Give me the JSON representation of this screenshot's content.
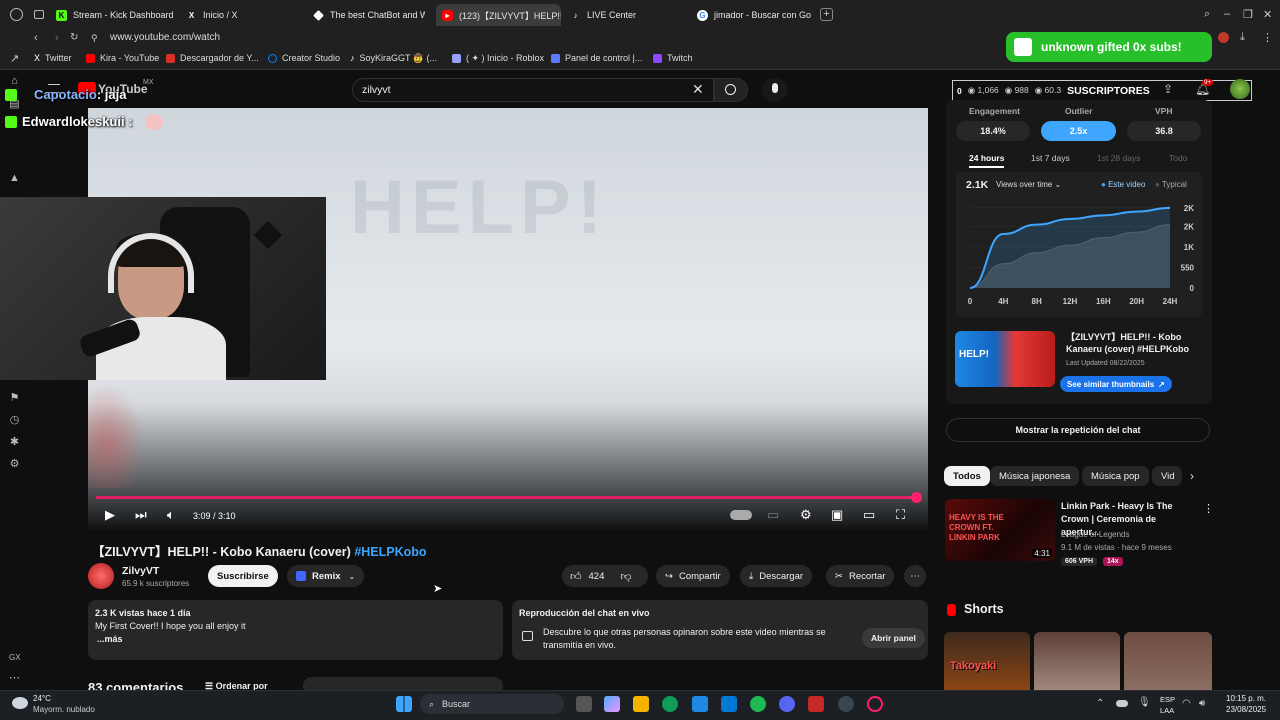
{
  "browser": {
    "tabs": [
      {
        "label": "Stream - Kick Dashboard",
        "icon": "kick-icon",
        "color": "#53fc18"
      },
      {
        "label": "Inicio / X",
        "icon": "x-icon",
        "color": "#ffffff"
      },
      {
        "label": "The best ChatBot and Wi",
        "icon": "chatbot-icon",
        "color": "#ffffff"
      },
      {
        "label": "(123)【ZILVYVT】HELP!! -",
        "icon": "youtube-icon",
        "color": "#ff0000"
      },
      {
        "label": "LIVE Center",
        "icon": "tiktok-icon",
        "color": "#ffffff"
      },
      {
        "label": "jimador - Buscar con Goo",
        "icon": "google-icon",
        "color": "#4285f4"
      }
    ],
    "url": "www.youtube.com/watch",
    "bookmarks": [
      {
        "label": "Twitter",
        "icon": "x-icon",
        "color": "#ffffff"
      },
      {
        "label": "Kira - YouTube",
        "icon": "youtube-icon",
        "color": "#ff0000"
      },
      {
        "label": "Descargador de Y...",
        "icon": "download-icon",
        "color": "#d93025"
      },
      {
        "label": "Creator Studio",
        "icon": "meta-icon",
        "color": "#0a7cff"
      },
      {
        "label": "SoyKiraGGT 🤠 (...",
        "icon": "tiktok-icon",
        "color": "#ffffff"
      },
      {
        "label": "( ✦ ) Inicio - Roblox",
        "icon": "roblox-icon",
        "color": "#9aa0ff"
      },
      {
        "label": "Panel de control |...",
        "icon": "panel-icon",
        "color": "#5b7cff"
      },
      {
        "label": "Twitch",
        "icon": "twitch-icon",
        "color": "#9146ff"
      }
    ]
  },
  "overlay": {
    "gifted_subs": "unknown gifted 0x subs!",
    "chat": [
      {
        "user": "Capotacio",
        "text": ": jaja"
      },
      {
        "user": "Edwardlokeskuii",
        "text": ":"
      }
    ]
  },
  "youtube": {
    "logo": "YouTube",
    "region": "MX",
    "search_value": "zilvyvt",
    "stats": {
      "a": "0",
      "b": "1,066",
      "c": "988",
      "d": "60.3",
      "subs_label": "SUSCRIPTORES",
      "notif": "9+"
    },
    "player": {
      "time": "3:09 / 3:10",
      "watermark": "HELP!",
      "progress": 0.996
    },
    "title": "【ZILVYVT】HELP!! - Kobo Kanaeru (cover)",
    "hashtag": "#HELPKobo",
    "channel": {
      "name": "ZilvyVT",
      "subs": "65.9 k suscriptores"
    },
    "subscribe": "Suscribirse",
    "remix": "Remix",
    "likes": "424",
    "share": "Compartir",
    "download": "Descargar",
    "clip": "Recortar",
    "description": {
      "stats": "2.3 K vistas  hace 1 día",
      "text": "My First Cover!! I hope you all enjoy it",
      "more": "...más"
    },
    "chat_replay": {
      "title": "Reproducción del chat en vivo",
      "text": "Descubre lo que otras personas opinaron sobre este video mientras se transmitía en vivo.",
      "button": "Abrir panel"
    },
    "comments": "83 comentarios",
    "sort": "Ordenar por",
    "show_chat": "Mostrar la repetición del chat"
  },
  "analytics": {
    "metrics": [
      {
        "label": "Engagement",
        "value": "18.4%"
      },
      {
        "label": "Outlier",
        "value": "2.5x"
      },
      {
        "label": "VPH",
        "value": "36.8"
      }
    ],
    "ranges": [
      "24 hours",
      "1st 7 days",
      "1st 28 days",
      "Todo"
    ],
    "views": "2.1K",
    "view_mode": "Views over time",
    "legend": [
      "Este video",
      "Typical"
    ],
    "chart_data": {
      "type": "area",
      "x": [
        "0",
        "4H",
        "8H",
        "12H",
        "16H",
        "20H",
        "24H"
      ],
      "series": [
        {
          "name": "Este video",
          "values": [
            0,
            1450,
            1700,
            1850,
            1950,
            2050,
            2150
          ]
        },
        {
          "name": "Typical",
          "values": [
            0,
            650,
            950,
            1150,
            1350,
            1500,
            1700
          ]
        }
      ],
      "y_ticks": [
        "0",
        "550",
        "1K",
        "2K",
        "2K"
      ],
      "ylim": [
        0,
        2200
      ]
    },
    "similar": {
      "title": "【ZILVYVT】HELP!! - Kobo Kanaeru (cover) #HELPKobo",
      "updated": "Last Updated 08/22/2025",
      "button": "See similar thumbnails"
    }
  },
  "recommended": {
    "chips": [
      "Todos",
      "Música japonesa",
      "Música pop",
      "Vid"
    ],
    "video": {
      "title": "Linkin Park - Heavy Is The Crown | Ceremonia de apertur...",
      "channel": "League of Legends",
      "meta": "9.1 M de vistas · hace 9 meses",
      "duration": "4:31",
      "vph": "606 VPH",
      "mult": "14x",
      "thumb_text": "HEAVY IS THE CROWN FT. LINKIN PARK"
    },
    "shorts": "Shorts",
    "shorts_thumb": "Takoyaki"
  },
  "taskbar": {
    "weather_temp": "24°C",
    "weather_text": "Mayorm. nublado",
    "search": "Buscar",
    "lang1": "ESP",
    "lang2": "LAA",
    "time": "10:15 p. m.",
    "date": "23/08/2025"
  },
  "colors": {
    "accent_blue": "#3ea6ff",
    "progress_red": "#ff1f6a",
    "gift_green": "#27c02a"
  }
}
